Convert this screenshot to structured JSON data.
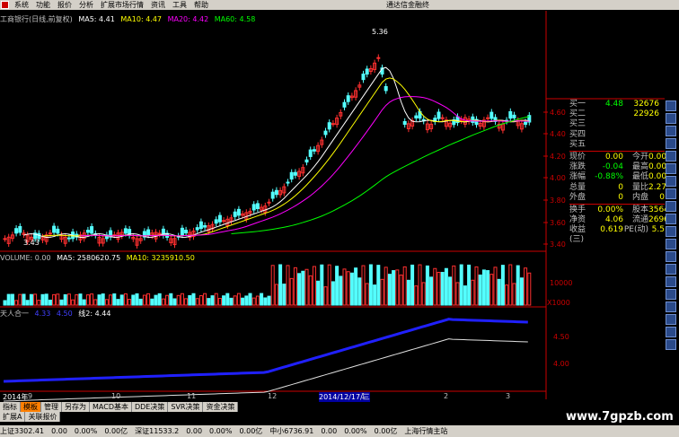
{
  "menu": [
    "系统",
    "功能",
    "报价",
    "分析",
    "扩展市场行情",
    "资讯",
    "工具",
    "帮助"
  ],
  "brand": "通达信金融终",
  "kline": {
    "title": "工商银行(日线,前复权)",
    "ma5": "MA5: 4.41",
    "ma10": "MA10: 4.47",
    "ma20": "MA20: 4.42",
    "ma60": "MA60: 4.58",
    "high_label": "5.36",
    "low_label": "3.43",
    "yticks": [
      "4.60",
      "4.40",
      "4.20",
      "4.00",
      "3.80",
      "3.60",
      "3.40"
    ]
  },
  "volume": {
    "label": "VOLUME: 0.00",
    "ma5": "MA5: 2580620.75",
    "ma10": "MA10: 3235910.50",
    "ytick": "10000",
    "unit": "X1000"
  },
  "indicator": {
    "name": "天人合一",
    "v1": "4.33",
    "v2": "4.50",
    "v3": "线2: 4.44",
    "yticks": [
      "4.50",
      "4.00"
    ]
  },
  "dates": [
    "2014年",
    "9",
    "10",
    "11",
    "12",
    "2014/12/17/三",
    "1",
    "2",
    "3"
  ],
  "quote": {
    "buy": [
      {
        "l": "买一",
        "p": "4.48",
        "v": "32676"
      },
      {
        "l": "买二",
        "p": "",
        "v": "22926"
      },
      {
        "l": "买三",
        "p": "",
        "v": ""
      },
      {
        "l": "买四",
        "p": "",
        "v": ""
      },
      {
        "l": "买五",
        "p": "",
        "v": ""
      }
    ],
    "rows": [
      {
        "l": "现价",
        "v": "0.00",
        "l2": "今开",
        "v2": "0.00"
      },
      {
        "l": "涨跌",
        "v": "-0.04",
        "l2": "最高",
        "v2": "0.00"
      },
      {
        "l": "涨幅",
        "v": "-0.88%",
        "l2": "最低",
        "v2": "0.00"
      },
      {
        "l": "总量",
        "v": "0",
        "l2": "量比",
        "v2": "2.27"
      },
      {
        "l": "外盘",
        "v": "0",
        "l2": "内盘",
        "v2": "0"
      }
    ],
    "rows2": [
      {
        "l": "换手",
        "v": "0.00%",
        "l2": "股本",
        "v2": "3564"
      },
      {
        "l": "净资",
        "v": "4.06",
        "l2": "流通",
        "v2": "2696"
      },
      {
        "l": "收益(三)",
        "v": "0.619",
        "l2": "PE(动)",
        "v2": "5.5"
      }
    ]
  },
  "ctrl_tabs": [
    "指标",
    "模板",
    "管理",
    "另存为",
    "MACD基本",
    "DDE决策",
    "SVR决策",
    "资金决策"
  ],
  "sub_tabs": [
    "扩展A",
    "关联报价"
  ],
  "status": {
    "sh": "上证3302.41",
    "sh_a": "0.00",
    "sh_b": "0.00%",
    "sh_c": "0.00亿",
    "sz": "深证11533.2",
    "sz_a": "0.00",
    "sz_b": "0.00%",
    "sz_c": "0.00亿",
    "zx": "中小6736.91",
    "zx_a": "0.00",
    "zx_b": "0.00%",
    "zx_c": "0.00亿",
    "station": "上海行情主站"
  },
  "watermark": "www.7gpzb.com"
}
